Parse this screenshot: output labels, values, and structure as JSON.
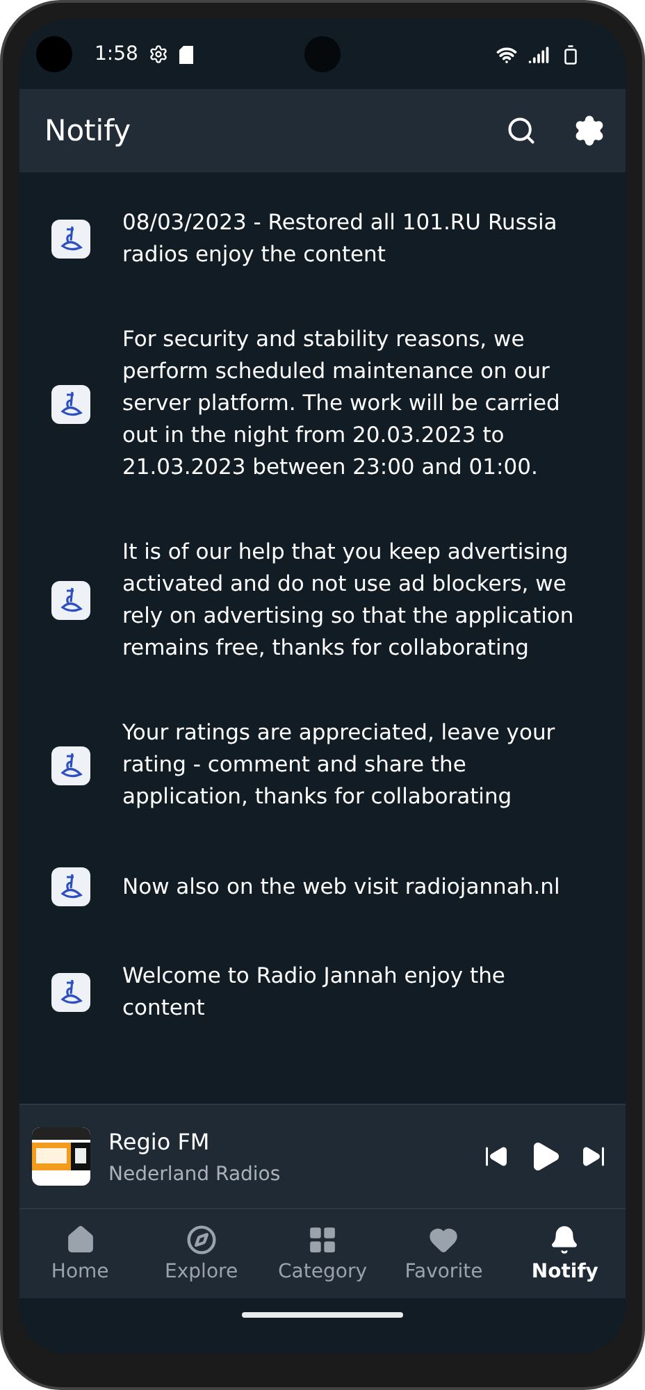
{
  "status_bar": {
    "time": "1:58"
  },
  "app_bar": {
    "title": "Notify"
  },
  "notifications": [
    {
      "text": "08/03/2023 - Restored all 101.RU Russia radios enjoy the content"
    },
    {
      "text": "For security and stability reasons, we perform scheduled maintenance on our server platform. The work will be carried out in the night from 20.03.2023 to 21.03.2023 between 23:00 and 01:00."
    },
    {
      "text": "It is of our help that you keep advertising activated and do not use ad blockers, we rely on advertising so that the application remains free, thanks for collaborating"
    },
    {
      "text": "Your ratings are appreciated, leave your rating - comment and share the application, thanks for collaborating"
    },
    {
      "text": "Now also on the web visit radiojannah.nl"
    },
    {
      "text": "Welcome to Radio Jannah enjoy the content"
    }
  ],
  "player": {
    "station": "Regio FM",
    "subtitle": "Nederland Radios"
  },
  "bottom_nav": [
    {
      "label": "Home",
      "selected": false
    },
    {
      "label": "Explore",
      "selected": false
    },
    {
      "label": "Category",
      "selected": false
    },
    {
      "label": "Favorite",
      "selected": false
    },
    {
      "label": "Notify",
      "selected": true
    }
  ]
}
